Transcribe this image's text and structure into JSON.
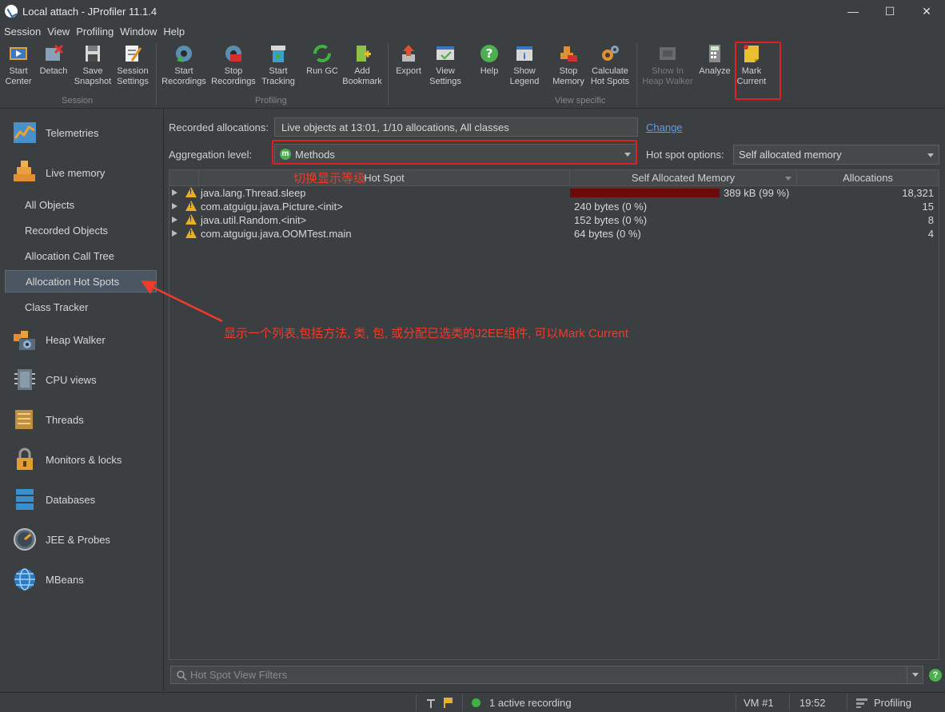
{
  "window": {
    "title": "Local attach - JProfiler 11.1.4",
    "minimize": "—",
    "maximize": "☐",
    "close": "✕"
  },
  "menu": [
    "Session",
    "View",
    "Profiling",
    "Window",
    "Help"
  ],
  "toolbar": {
    "buttons": [
      {
        "line1": "Start",
        "line2": "Center",
        "icon": "start-center-icon"
      },
      {
        "line1": "Detach",
        "line2": "",
        "icon": "detach-icon"
      },
      {
        "line1": "Save",
        "line2": "Snapshot",
        "icon": "save-snapshot-icon"
      },
      {
        "line1": "Session",
        "line2": "Settings",
        "icon": "session-settings-icon"
      },
      {
        "line1": "Start",
        "line2": "Recordings",
        "icon": "start-recordings-icon"
      },
      {
        "line1": "Stop",
        "line2": "Recordings",
        "icon": "stop-recordings-icon"
      },
      {
        "line1": "Start",
        "line2": "Tracking",
        "icon": "start-tracking-icon"
      },
      {
        "line1": "Run GC",
        "line2": "",
        "icon": "run-gc-icon"
      },
      {
        "line1": "Add",
        "line2": "Bookmark",
        "icon": "add-bookmark-icon"
      },
      {
        "line1": "Export",
        "line2": "",
        "icon": "export-icon"
      },
      {
        "line1": "View",
        "line2": "Settings",
        "icon": "view-settings-icon"
      },
      {
        "line1": "Help",
        "line2": "",
        "icon": "help-icon"
      },
      {
        "line1": "Show",
        "line2": "Legend",
        "icon": "show-legend-icon"
      },
      {
        "line1": "Stop",
        "line2": "Memory",
        "icon": "stop-memory-icon"
      },
      {
        "line1": "Calculate",
        "line2": "Hot Spots",
        "icon": "calculate-hot-spots-icon"
      },
      {
        "line1": "Show In",
        "line2": "Heap Walker",
        "icon": "show-in-heap-walker-icon"
      },
      {
        "line1": "Analyze",
        "line2": "",
        "icon": "analyze-icon"
      },
      {
        "line1": "Mark",
        "line2": "Current",
        "icon": "mark-current-icon"
      }
    ],
    "groups": [
      "Session",
      "Profiling",
      "View specific"
    ]
  },
  "sidebar": {
    "sections": [
      {
        "label": "Telemetries",
        "icon": "telemetries-icon"
      },
      {
        "label": "Live memory",
        "icon": "live-memory-icon"
      },
      {
        "label": "Heap Walker",
        "icon": "heap-walker-icon"
      },
      {
        "label": "CPU views",
        "icon": "cpu-views-icon"
      },
      {
        "label": "Threads",
        "icon": "threads-icon"
      },
      {
        "label": "Monitors & locks",
        "icon": "monitors-locks-icon"
      },
      {
        "label": "Databases",
        "icon": "databases-icon"
      },
      {
        "label": "JEE & Probes",
        "icon": "jee-probes-icon"
      },
      {
        "label": "MBeans",
        "icon": "mbeans-icon"
      }
    ],
    "live_memory_items": [
      "All Objects",
      "Recorded Objects",
      "Allocation Call Tree",
      "Allocation Hot Spots",
      "Class Tracker"
    ],
    "selected": "Allocation Hot Spots"
  },
  "content": {
    "recorded_label": "Recorded allocations:",
    "recorded_value": "Live objects at 13:01, 1/10 allocations, All classes",
    "change_link": "Change",
    "aggregation_label": "Aggregation level:",
    "aggregation_value": "Methods",
    "aggregation_badge": "m",
    "hotspot_options_label": "Hot spot options:",
    "hotspot_options_value": "Self allocated memory"
  },
  "table": {
    "columns": [
      "Hot Spot",
      "Self Allocated Memory",
      "Allocations"
    ],
    "rows": [
      {
        "name": "java.lang.Thread.sleep",
        "memory": "389 kB (99 %)",
        "fraction": 0.99,
        "allocations": "18,321"
      },
      {
        "name": "com.atguigu.java.Picture.<init>",
        "memory": "240 bytes (0 %)",
        "fraction": 0,
        "allocations": "15"
      },
      {
        "name": "java.util.Random.<init>",
        "memory": "152 bytes (0 %)",
        "fraction": 0,
        "allocations": "8"
      },
      {
        "name": "com.atguigu.java.OOMTest.main",
        "memory": "64 bytes (0 %)",
        "fraction": 0,
        "allocations": "4"
      }
    ]
  },
  "annotations": {
    "switch_level": "切换显示等级",
    "description": "显示一个列表,包括方法, 类, 包, 或分配已选类的J2EE组件, 可以Mark Current"
  },
  "filter": {
    "placeholder": "Hot Spot View Filters"
  },
  "status": {
    "recording": "1 active recording",
    "vm": "VM #1",
    "time": "19:52",
    "mode": "Profiling",
    "help": "?"
  },
  "colors": {
    "annotation": "#f03a2a",
    "bar": "#6b0a0a",
    "link": "#589df6",
    "recording_dot": "#3fb23f"
  }
}
